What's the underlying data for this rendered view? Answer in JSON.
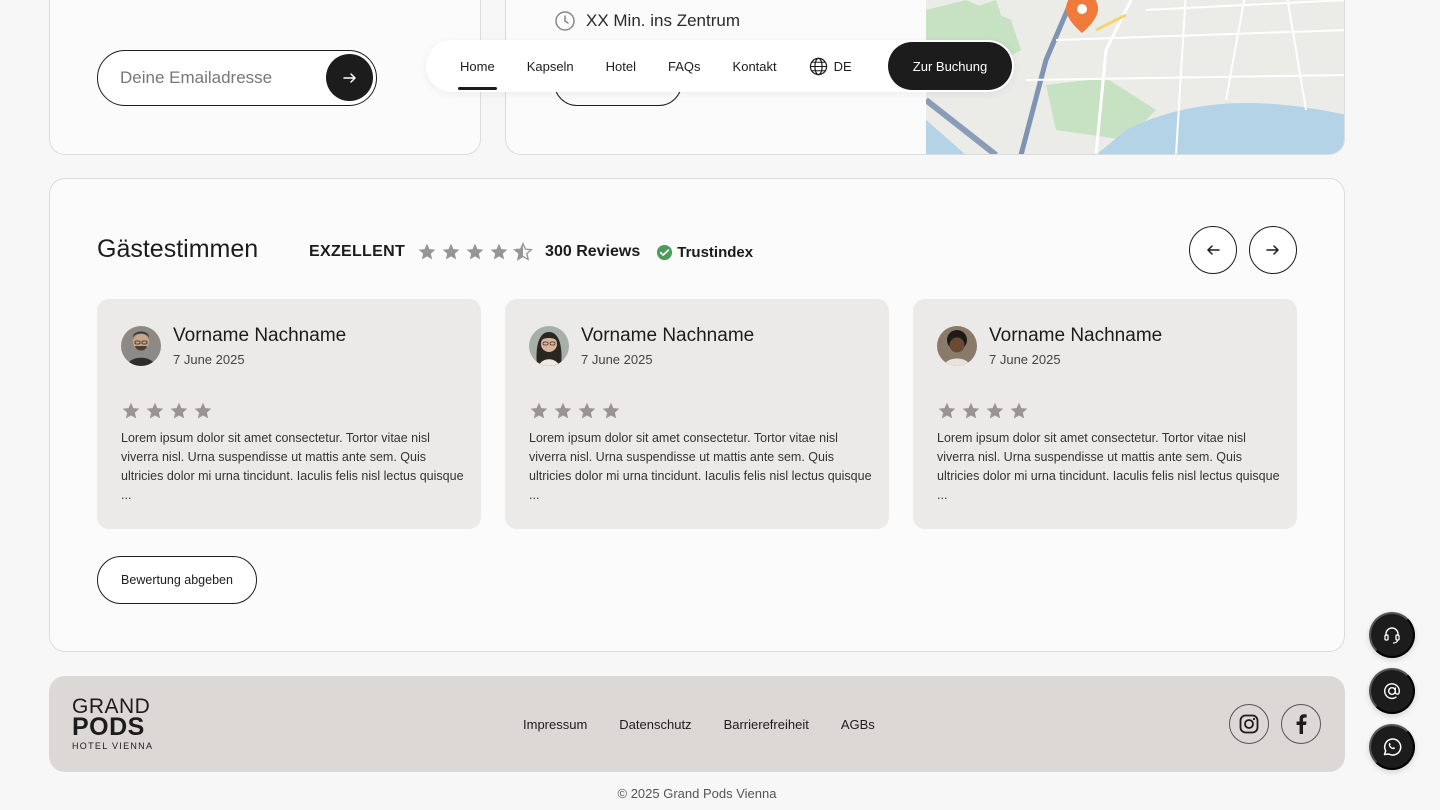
{
  "newsletter": {
    "email_placeholder": "Deine Emailadresse"
  },
  "location": {
    "travel_time": "XX Min. ins Zentrum"
  },
  "nav": {
    "items": [
      {
        "label": "Home",
        "active": true
      },
      {
        "label": "Kapseln",
        "active": false
      },
      {
        "label": "Hotel",
        "active": false
      },
      {
        "label": "FAQs",
        "active": false
      },
      {
        "label": "Kontakt",
        "active": false
      }
    ],
    "language": "DE",
    "cta_label": "Zur Buchung"
  },
  "reviews": {
    "title": "Gästestimmen",
    "rating_label": "EXZELLENT",
    "rating_stars": 4.5,
    "count_label": "300 Reviews",
    "provider": "Trustindex",
    "cards": [
      {
        "name": "Vorname Nachname",
        "date": "7 June 2025",
        "stars": 4,
        "text": "Lorem ipsum dolor sit amet consectetur. Tortor vitae nisl viverra nisl. Urna suspendisse ut mattis ante sem. Quis ultricies dolor mi urna tincidunt. Iaculis felis nisl lectus quisque ..."
      },
      {
        "name": "Vorname Nachname",
        "date": "7 June 2025",
        "stars": 4,
        "text": "Lorem ipsum dolor sit amet consectetur. Tortor vitae nisl viverra nisl. Urna suspendisse ut mattis ante sem. Quis ultricies dolor mi urna tincidunt. Iaculis felis nisl lectus quisque ..."
      },
      {
        "name": "Vorname Nachname",
        "date": "7 June 2025",
        "stars": 4,
        "text": "Lorem ipsum dolor sit amet consectetur. Tortor vitae nisl viverra nisl. Urna suspendisse ut mattis ante sem. Quis ultricies dolor mi urna tincidunt. Iaculis felis nisl lectus quisque ..."
      }
    ],
    "rate_button": "Bewertung abgeben"
  },
  "footer": {
    "logo": {
      "line1": "GRAND",
      "line2": "PODS",
      "line3": "HOTEL VIENNA"
    },
    "links": [
      "Impressum",
      "Datenschutz",
      "Barrierefreiheit",
      "AGBs"
    ],
    "social": [
      "instagram-icon",
      "facebook-icon"
    ],
    "copyright": "© 2025 Grand Pods Vienna"
  },
  "colors": {
    "dark": "#1c1c1c",
    "card_bg": "#ebeae9",
    "footer_bg": "#dcd8d6",
    "star_gray": "#9a9594",
    "trust_green": "#4a9d5b",
    "map_pin": "#f07a3a"
  }
}
